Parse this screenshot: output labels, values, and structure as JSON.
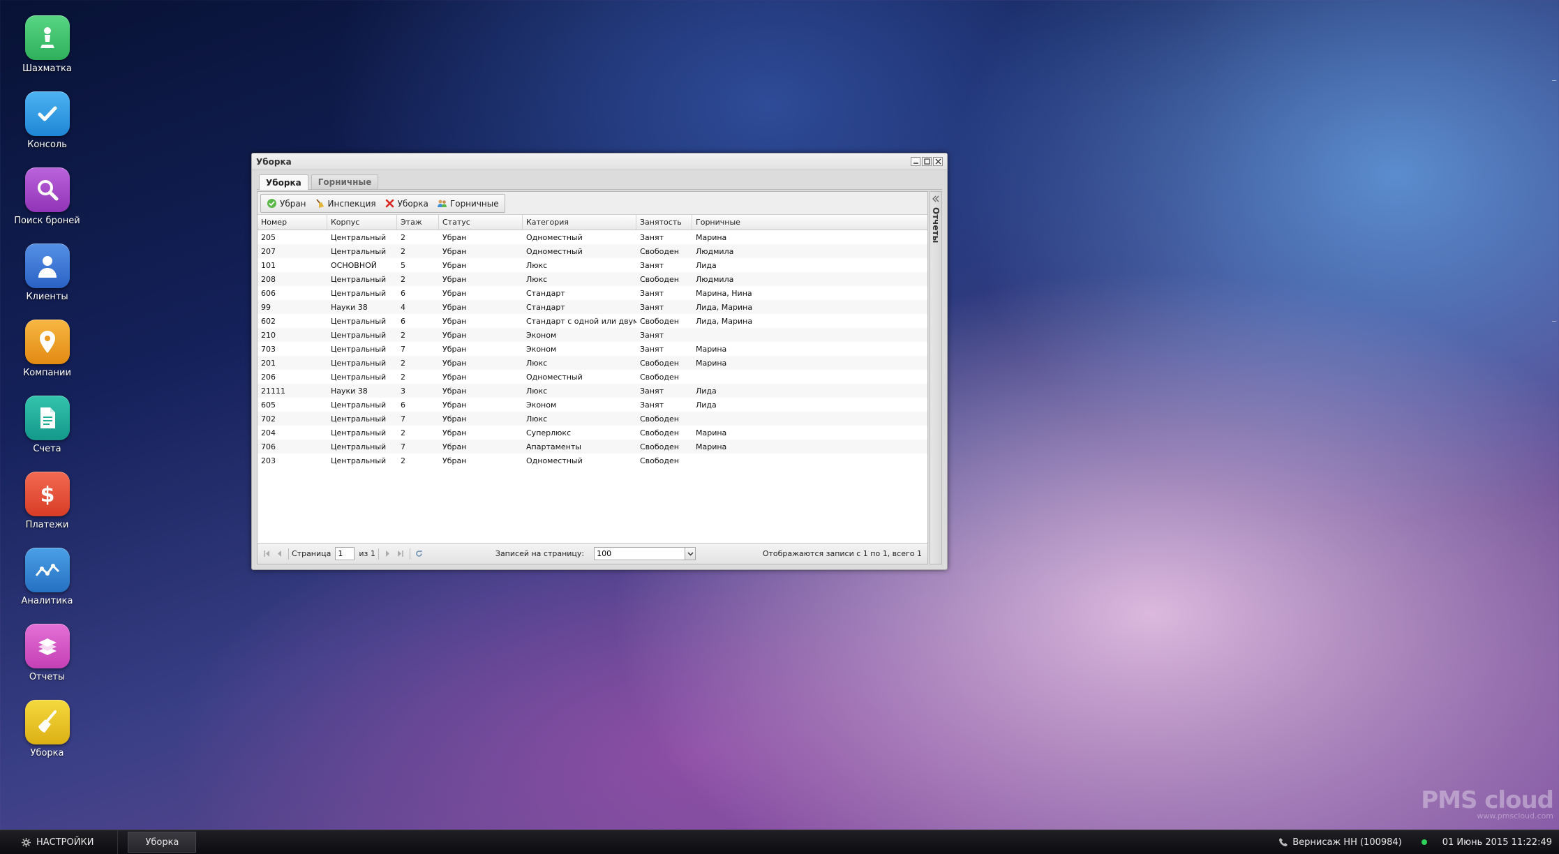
{
  "desktop": {
    "icons": [
      {
        "label": "Шахматка",
        "color": "#3fc06c",
        "icon": "chess-pawn-icon"
      },
      {
        "label": "Консоль",
        "color": "#2e9be8",
        "icon": "checkmark-icon"
      },
      {
        "label": "Поиск броней",
        "color": "#a547c9",
        "icon": "magnifier-icon"
      },
      {
        "label": "Клиенты",
        "color": "#3a78d8",
        "icon": "user-icon"
      },
      {
        "label": "Компании",
        "color": "#f2a22a",
        "icon": "location-pin-icon"
      },
      {
        "label": "Счета",
        "color": "#1fae98",
        "icon": "document-icon"
      },
      {
        "label": "Платежи",
        "color": "#e9503a",
        "icon": "dollar-icon"
      },
      {
        "label": "Аналитика",
        "color": "#2f86d6",
        "icon": "line-chart-icon"
      },
      {
        "label": "Отчеты",
        "color": "#d455c6",
        "icon": "books-icon"
      },
      {
        "label": "Уборка",
        "color": "#e9c52a",
        "icon": "broom-icon"
      }
    ]
  },
  "window": {
    "title": "Уборка",
    "tabs": [
      "Уборка",
      "Горничные"
    ],
    "toolbar": {
      "clean_label": "Убран",
      "inspect_label": "Инспекция",
      "cleaning_label": "Уборка",
      "maids_label": "Горничные"
    },
    "columns": [
      "Номер",
      "Корпус",
      "Этаж",
      "Статус",
      "Категория",
      "Занятость",
      "Горничные"
    ],
    "rows": [
      [
        "205",
        "Центральный",
        "2",
        "Убран",
        "Одноместный",
        "Занят",
        "Марина"
      ],
      [
        "207",
        "Центральный",
        "2",
        "Убран",
        "Одноместный",
        "Свободен",
        "Людмила"
      ],
      [
        "101",
        "ОСНОВНОЙ",
        "5",
        "Убран",
        "Люкс",
        "Занят",
        "Лида"
      ],
      [
        "208",
        "Центральный",
        "2",
        "Убран",
        "Люкс",
        "Свободен",
        "Людмила"
      ],
      [
        "606",
        "Центральный",
        "6",
        "Убран",
        "Стандарт",
        "Занят",
        "Марина, Нина"
      ],
      [
        "99",
        "Науки 38",
        "4",
        "Убран",
        "Стандарт",
        "Занят",
        "Лида, Марина"
      ],
      [
        "602",
        "Центральный",
        "6",
        "Убран",
        "Стандарт с одной или двум...",
        "Свободен",
        "Лида, Марина"
      ],
      [
        "210",
        "Центральный",
        "2",
        "Убран",
        "Эконом",
        "Занят",
        ""
      ],
      [
        "703",
        "Центральный",
        "7",
        "Убран",
        "Эконом",
        "Занят",
        "Марина"
      ],
      [
        "201",
        "Центральный",
        "2",
        "Убран",
        "Люкс",
        "Свободен",
        "Марина"
      ],
      [
        "206",
        "Центральный",
        "2",
        "Убран",
        "Одноместный",
        "Свободен",
        ""
      ],
      [
        "21111",
        "Науки 38",
        "3",
        "Убран",
        "Люкс",
        "Занят",
        "Лида"
      ],
      [
        "605",
        "Центральный",
        "6",
        "Убран",
        "Эконом",
        "Занят",
        "Лида"
      ],
      [
        "702",
        "Центральный",
        "7",
        "Убран",
        "Люкс",
        "Свободен",
        ""
      ],
      [
        "204",
        "Центральный",
        "2",
        "Убран",
        "Суперлюкс",
        "Свободен",
        "Марина"
      ],
      [
        "706",
        "Центральный",
        "7",
        "Убран",
        "Апартаменты",
        "Свободен",
        "Марина"
      ],
      [
        "203",
        "Центральный",
        "2",
        "Убран",
        "Одноместный",
        "Свободен",
        ""
      ]
    ],
    "pager": {
      "page_label": "Страница",
      "page_value": "1",
      "of_label": "из 1",
      "per_page_label": "Записей на страницу:",
      "per_page_value": "100",
      "info": "Отображаются записи с 1 по 1, всего 1"
    },
    "side_panel_label": "Отчеты"
  },
  "taskbar": {
    "settings_label": "НАСТРОЙКИ",
    "task_label": "Уборка",
    "hotel": "Вернисаж НН (100984)",
    "datetime": "01 Июнь 2015 11:22:49"
  },
  "logo": {
    "main": "PMS cloud",
    "sub": "www.pmscloud.com"
  }
}
